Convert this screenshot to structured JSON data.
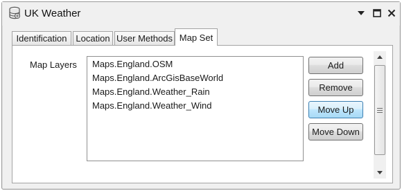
{
  "window": {
    "title": "UK Weather",
    "icons": {
      "app": "database-icon",
      "dropdown": "pin-dropdown-icon",
      "maximize": "maximize-icon",
      "close": "close-icon"
    }
  },
  "tabs": [
    {
      "label": "Identification",
      "active": false
    },
    {
      "label": "Location",
      "active": false
    },
    {
      "label": "User Methods",
      "active": false
    },
    {
      "label": "Map Set",
      "active": true
    }
  ],
  "map_set": {
    "label": "Map Layers",
    "layers": [
      "Maps.England.OSM",
      "Maps.England.ArcGisBaseWorld",
      "Maps.England.Weather_Rain",
      "Maps.England.Weather_Wind"
    ],
    "buttons": {
      "add": "Add",
      "remove": "Remove",
      "move_up": "Move Up",
      "move_down": "Move Down"
    },
    "hovered_button": "move_up"
  },
  "colors": {
    "hover_border": "#3c7fb1",
    "hover_fill": "#bee6fd"
  }
}
